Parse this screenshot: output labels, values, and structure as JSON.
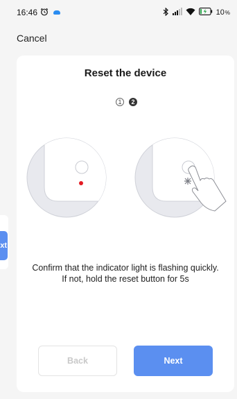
{
  "status_bar": {
    "time": "16:46",
    "alarm_icon": "alarm-clock-icon",
    "cloud_icon": "cloud-icon",
    "bluetooth_icon": "bluetooth-icon",
    "signal_icon": "signal-icon",
    "wifi_icon": "wifi-icon",
    "battery_icon": "battery-charging-icon",
    "battery_level": "10"
  },
  "header": {
    "cancel_label": "Cancel"
  },
  "background_card": {
    "button_label": "Next"
  },
  "card": {
    "title": "Reset the device",
    "steps": [
      {
        "label": "1",
        "active": false
      },
      {
        "label": "2",
        "active": true
      }
    ],
    "instruction": "Confirm that the indicator light is flashing quickly. If not, hold the reset button for 5s",
    "back_label": "Back",
    "next_label": "Next"
  },
  "colors": {
    "accent": "#5b8ff0",
    "indicator_red": "#e31b23",
    "background": "#f5f5f5"
  }
}
